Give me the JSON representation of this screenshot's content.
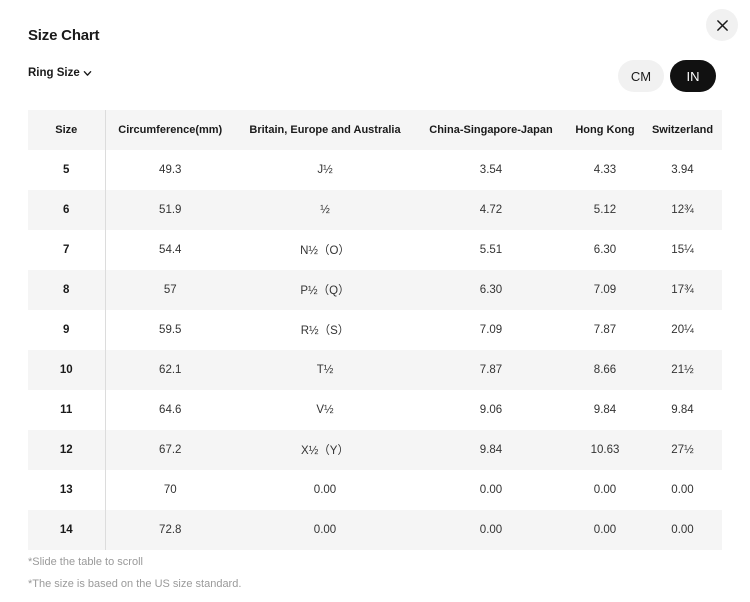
{
  "header": {
    "title": "Size Chart"
  },
  "filter": {
    "label": "Ring Size"
  },
  "units": {
    "cm": "CM",
    "in": "IN",
    "selected": "IN"
  },
  "table": {
    "headers": [
      "Size",
      "Circumference(mm)",
      "Britain, Europe and Australia",
      "China-Singapore-Japan",
      "Hong Kong",
      "Switzerland"
    ],
    "rows": [
      [
        "5",
        "49.3",
        "J½",
        "3.54",
        "4.33",
        "3.94"
      ],
      [
        "6",
        "51.9",
        "½",
        "4.72",
        "5.12",
        "12¾"
      ],
      [
        "7",
        "54.4",
        "N½（O）",
        "5.51",
        "6.30",
        "15¼"
      ],
      [
        "8",
        "57",
        "P½（Q）",
        "6.30",
        "7.09",
        "17¾"
      ],
      [
        "9",
        "59.5",
        "R½（S）",
        "7.09",
        "7.87",
        "20¼"
      ],
      [
        "10",
        "62.1",
        "T½",
        "7.87",
        "8.66",
        "21½"
      ],
      [
        "11",
        "64.6",
        "V½",
        "9.06",
        "9.84",
        "9.84"
      ],
      [
        "12",
        "67.2",
        "X½（Y）",
        "9.84",
        "10.63",
        "27½"
      ],
      [
        "13",
        "70",
        "0.00",
        "0.00",
        "0.00",
        "0.00"
      ],
      [
        "14",
        "72.8",
        "0.00",
        "0.00",
        "0.00",
        "0.00"
      ]
    ]
  },
  "notes": {
    "scroll": "*Slide the table to scroll",
    "standard": "*The size is based on the US size standard."
  }
}
